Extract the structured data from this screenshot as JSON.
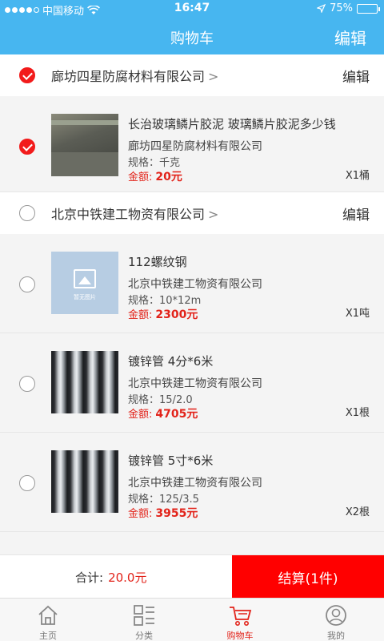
{
  "status_bar": {
    "carrier": "中国移动",
    "time": "16:47",
    "battery": "75%"
  },
  "nav": {
    "title": "购物车",
    "edit": "编辑"
  },
  "shops": [
    {
      "name": "廊坊四星防腐材料有限公司",
      "chevron": ">",
      "edit": "编辑",
      "checked": true,
      "items": [
        {
          "title": "长治玻璃鳞片胶泥 玻璃鳞片胶泥多少钱",
          "shop": "廊坊四星防腐材料有限公司",
          "spec_label": "规格：",
          "spec": "千克",
          "price_label": "金额:",
          "price": "20元",
          "qty": "X1桶",
          "checked": true
        }
      ]
    },
    {
      "name": "北京中铁建工物资有限公司",
      "chevron": ">",
      "edit": "编辑",
      "checked": false,
      "items": [
        {
          "title": "112螺纹钢",
          "shop": "北京中铁建工物资有限公司",
          "spec_label": "规格：",
          "spec": "10*12m",
          "price_label": "金额:",
          "price": "2300元",
          "qty": "X1吨",
          "checked": false
        },
        {
          "title": "镀锌管 4分*6米",
          "shop": "北京中铁建工物资有限公司",
          "spec_label": "规格：",
          "spec": "15/2.0",
          "price_label": "金额:",
          "price": "4705元",
          "qty": "X1根",
          "checked": false
        },
        {
          "title": "镀锌管 5寸*6米",
          "shop": "北京中铁建工物资有限公司",
          "spec_label": "规格：",
          "spec": "125/3.5",
          "price_label": "金额:",
          "price": "3955元",
          "qty": "X2根",
          "checked": false
        }
      ]
    }
  ],
  "placeholder_text": "暂无图片",
  "checkout": {
    "total_label": "合计:",
    "total_value": "20.0元",
    "settle_label": "结算(1件)"
  },
  "tabs": [
    {
      "label": "主页",
      "icon": "home-icon"
    },
    {
      "label": "分类",
      "icon": "category-icon"
    },
    {
      "label": "购物车",
      "icon": "cart-icon",
      "active": true
    },
    {
      "label": "我的",
      "icon": "profile-icon"
    }
  ],
  "colors": {
    "accent": "#47b6f0",
    "price": "#e2231a",
    "checkout_button": "#ff0000"
  }
}
